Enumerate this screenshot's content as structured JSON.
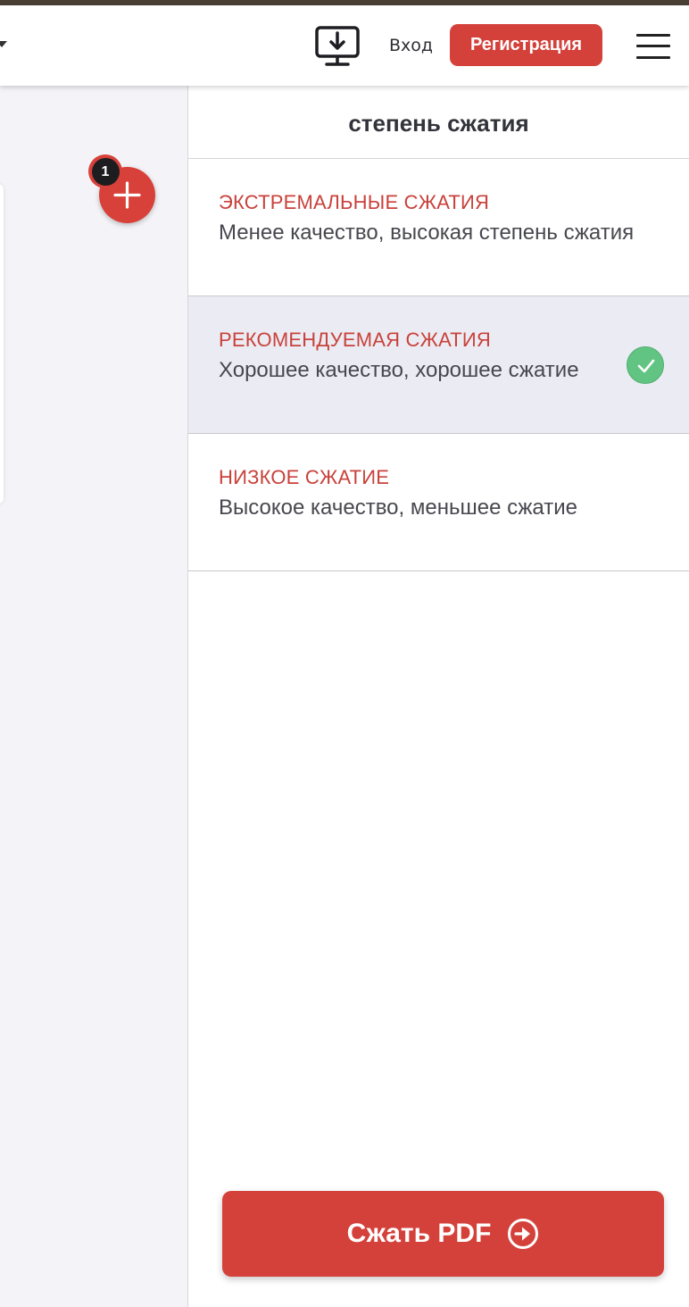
{
  "header": {
    "login_label": "Вход",
    "register_label": "Регистрация",
    "icons": [
      "chevron-down-icon",
      "desktop-download-icon",
      "hamburger-menu-icon"
    ]
  },
  "files": {
    "count": "1",
    "add_icon": "plus-icon"
  },
  "panel": {
    "title": "степень сжатия",
    "options": [
      {
        "title": "ЭКСТРЕМАЛЬНЫЕ СЖАТИЯ",
        "description": "Менее качество, высокая степень сжатия",
        "selected": false
      },
      {
        "title": "РЕКОМЕНДУЕМАЯ СЖАТИЯ",
        "description": "Хорошее качество, хорошее сжатие",
        "selected": true
      },
      {
        "title": "НИЗКОЕ СЖАТИЕ",
        "description": "Высокое качество, меньшее сжатие",
        "selected": false
      }
    ]
  },
  "action": {
    "label": "Сжать PDF",
    "icon": "arrow-right-circle-icon"
  },
  "colors": {
    "accent": "#d4413a",
    "selected_bg": "#ebecf3",
    "check": "#62c482"
  }
}
